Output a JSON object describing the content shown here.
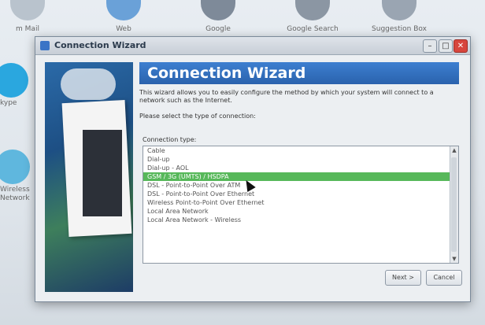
{
  "desktop": {
    "top_icons": [
      "m Mail",
      "Web",
      "Google",
      "Google Search",
      "Suggestion Box"
    ],
    "side_icons": [
      "kype",
      "Wireless Network"
    ]
  },
  "dialog": {
    "title": "Connection Wizard",
    "header": "Connection Wizard",
    "description": "This wizard allows you to easily configure the method by which your system will connect to a network such as the Internet.",
    "prompt": "Please select the type of connection:",
    "list_label": "Connection type:",
    "connection_types": [
      "Cable",
      "Dial-up",
      "Dial-up - AOL",
      "GSM / 3G (UMTS) / HSDPA",
      "DSL - Point-to-Point Over ATM",
      "DSL - Point-to-Point Over Ethernet",
      "Wireless Point-to-Point Over Ethernet",
      "Local Area Network",
      "Local Area Network - Wireless"
    ],
    "selected_index": 3,
    "next_button": "Next >",
    "cancel_button": "Cancel"
  },
  "colors": {
    "header_blue": "#2f6cc0",
    "selection_green": "#57b85a"
  }
}
